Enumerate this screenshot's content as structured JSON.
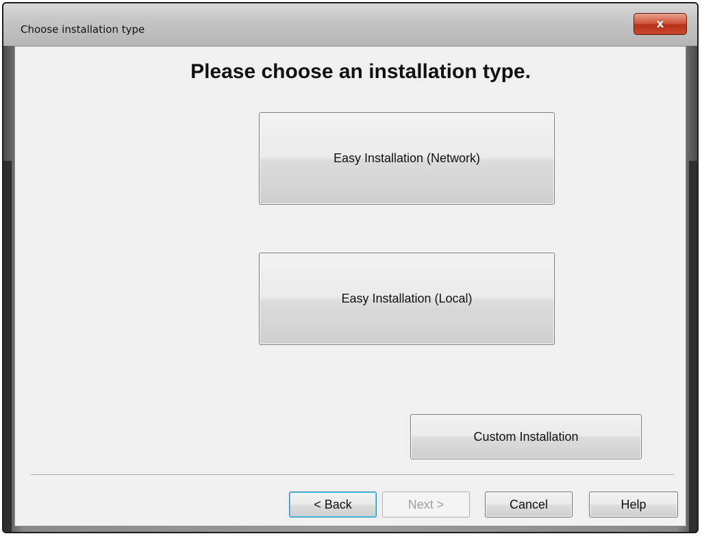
{
  "window": {
    "title": "Choose installation type",
    "close_glyph": "x"
  },
  "main": {
    "heading": "Please choose an installation type.",
    "options": {
      "network_label": "Easy Installation (Network)",
      "local_label": "Easy Installation (Local)",
      "custom_label": "Custom Installation"
    }
  },
  "footer": {
    "back_label": "< Back",
    "next_label": "Next >",
    "next_enabled": false,
    "cancel_label": "Cancel",
    "help_label": "Help"
  },
  "colors": {
    "close_button": "#c9482c",
    "focus_border": "#3c7fb1",
    "client_background": "#f0f0f0"
  }
}
